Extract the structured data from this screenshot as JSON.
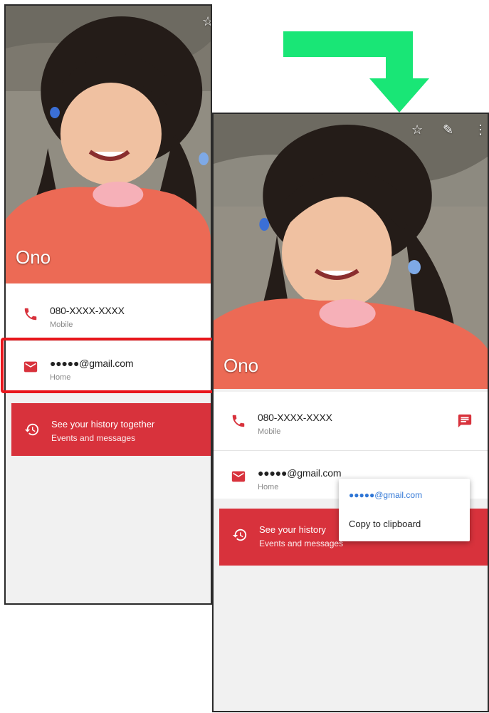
{
  "contact": {
    "name": "Ono",
    "phone": "080-XXXX-XXXX",
    "phone_type": "Mobile",
    "email": "●●●●●@gmail.com",
    "email_type": "Home"
  },
  "history": {
    "title": "See your history together",
    "title_truncated": "See your history",
    "subtitle": "Events and messages"
  },
  "toolbar": {
    "star_glyph": "☆",
    "edit_glyph": "✎",
    "more_glyph": "⋮"
  },
  "popup": {
    "email": "●●●●●@gmail.com",
    "copy_label": "Copy to clipboard"
  },
  "colors": {
    "accent_red": "#d8323c",
    "highlight_red": "#e8161c",
    "arrow_green": "#19e676",
    "link_blue": "#2f76d6"
  },
  "icons": [
    "phone-icon",
    "email-icon",
    "history-icon",
    "message-icon",
    "star-icon",
    "edit-icon",
    "more-icon"
  ]
}
